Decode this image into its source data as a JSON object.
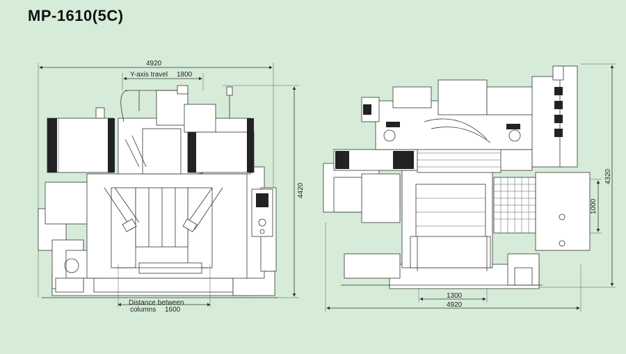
{
  "title": "MP-1610(5C)",
  "front_view": {
    "overall_width": "4920",
    "y_axis_travel_label": "Y-axis travel",
    "y_axis_travel_value": "1800",
    "overall_height": "4420",
    "distance_label_line1": "Distance between",
    "distance_label_line2": "columns",
    "distance_value": "1600"
  },
  "side_view": {
    "overall_width": "4920",
    "table_width": "1300",
    "overall_height": "4320",
    "table_height": "1000"
  },
  "colors": {
    "background": "#d6ecd8",
    "line": "#333333",
    "fill": "#ffffff"
  }
}
